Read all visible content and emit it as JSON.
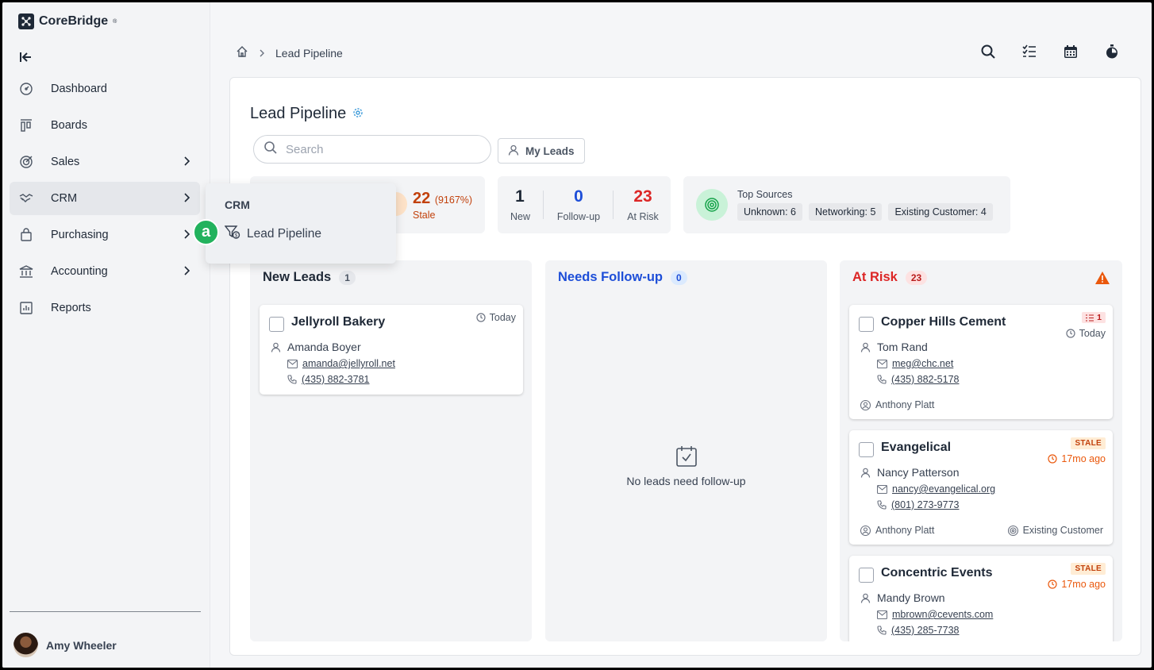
{
  "app": {
    "name": "CoreBridge",
    "trademark": "®"
  },
  "sidebar": {
    "items": [
      {
        "label": "Dashboard",
        "icon": "dashboard-icon"
      },
      {
        "label": "Boards",
        "icon": "boards-icon"
      },
      {
        "label": "Sales",
        "icon": "sales-icon"
      },
      {
        "label": "CRM",
        "icon": "crm-icon"
      },
      {
        "label": "Purchasing",
        "icon": "purchasing-icon"
      },
      {
        "label": "Accounting",
        "icon": "accounting-icon"
      },
      {
        "label": "Reports",
        "icon": "reports-icon"
      }
    ],
    "user": "Amy Wheeler"
  },
  "breadcrumb": {
    "current": "Lead Pipeline"
  },
  "page": {
    "title": "Lead Pipeline",
    "search_placeholder": "Search",
    "my_leads": "My Leads"
  },
  "stats": {
    "stale_count": "22",
    "stale_pct": "(9167%)",
    "stale_label": "Stale",
    "new_count": "1",
    "new_label": "New",
    "followup_count": "0",
    "followup_label": "Follow-up",
    "atrisk_count": "23",
    "atrisk_label": "At Risk",
    "sources_title": "Top Sources",
    "sources": [
      "Unknown: 6",
      "Networking: 5",
      "Existing Customer: 4"
    ]
  },
  "columns": {
    "new": {
      "title": "New Leads",
      "count": "1"
    },
    "followup": {
      "title": "Needs Follow-up",
      "count": "0",
      "empty": "No leads need follow-up"
    },
    "atrisk": {
      "title": "At Risk",
      "count": "23"
    }
  },
  "cards": {
    "jellyroll": {
      "name": "Jellyroll Bakery",
      "time": "Today",
      "person": "Amanda Boyer",
      "email": "amanda@jellyroll.net",
      "phone": "(435) 882-3781"
    },
    "copper": {
      "name": "Copper Hills Cement",
      "tasks": "1",
      "time": "Today",
      "person": "Tom Rand",
      "email": "meg@chc.net",
      "phone": "(435) 882-5178",
      "owner": "Anthony Platt"
    },
    "evangelical": {
      "name": "Evangelical",
      "tag": "STALE",
      "time": "17mo ago",
      "person": "Nancy Patterson",
      "email": "nancy@evangelical.org",
      "phone": "(801) 273-9773",
      "owner": "Anthony Platt",
      "source": "Existing Customer"
    },
    "concentric": {
      "name": "Concentric Events",
      "tag": "STALE",
      "time": "17mo ago",
      "person": "Mandy Brown",
      "email": "mbrown@cevents.com",
      "phone": "(435) 285-7738"
    }
  },
  "flyout": {
    "title": "CRM",
    "item": "Lead Pipeline",
    "marker": "a"
  },
  "colors": {
    "accent_green": "#22b25d",
    "stale_orange": "#ea580c",
    "risk_red": "#dc2626",
    "followup_blue": "#1d4ed8"
  }
}
